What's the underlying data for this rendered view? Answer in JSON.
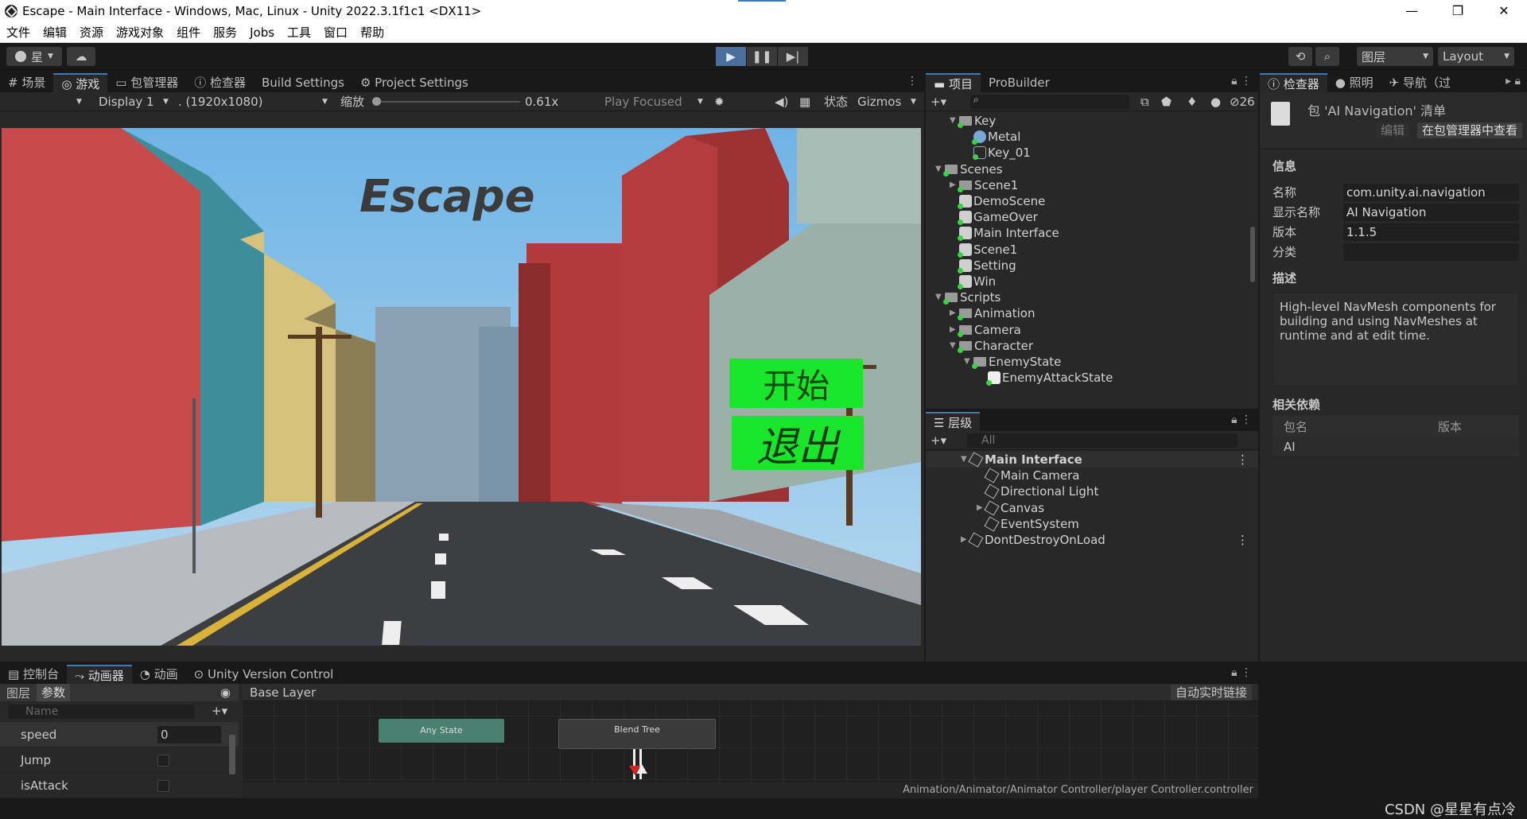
{
  "title_bar": {
    "text": "Escape - Main Interface - Windows, Mac, Linux - Unity 2022.3.1f1c1 <DX11>",
    "min": "—",
    "max": "❐",
    "close": "✕"
  },
  "menu": [
    "文件",
    "编辑",
    "资源",
    "游戏对象",
    "组件",
    "服务",
    "Jobs",
    "工具",
    "窗口",
    "帮助"
  ],
  "toolbar": {
    "account": "星",
    "layers": "图层",
    "layout": "Layout"
  },
  "game_panel": {
    "tabs": [
      "场景",
      "游戏",
      "包管理器",
      "检查器",
      "Build Settings",
      "Project Settings"
    ],
    "display": "Display 1",
    "resolution": ". (1920x1080)",
    "scale_label": "缩放",
    "scale_value": "0.61x",
    "play_mode": "Play Focused",
    "stats": "状态",
    "gizmos": "Gizmos",
    "game_title": "Escape",
    "start_button": "开始",
    "exit_button": "退出"
  },
  "project_panel": {
    "tabs": [
      "项目",
      "ProBuilder"
    ],
    "count": "26",
    "tree": [
      {
        "label": "Key",
        "depth": 2,
        "type": "folder",
        "open": true
      },
      {
        "label": "Metal",
        "depth": 3,
        "type": "material"
      },
      {
        "label": "Key_01",
        "depth": 3,
        "type": "mesh"
      },
      {
        "label": "Scenes",
        "depth": 1,
        "type": "folder",
        "open": true
      },
      {
        "label": "Scene1",
        "depth": 2,
        "type": "folder",
        "open": false
      },
      {
        "label": "DemoScene",
        "depth": 2,
        "type": "scene"
      },
      {
        "label": "GameOver",
        "depth": 2,
        "type": "scene"
      },
      {
        "label": "Main Interface",
        "depth": 2,
        "type": "scene"
      },
      {
        "label": "Scene1",
        "depth": 2,
        "type": "scene"
      },
      {
        "label": "Setting",
        "depth": 2,
        "type": "scene"
      },
      {
        "label": "Win",
        "depth": 2,
        "type": "scene"
      },
      {
        "label": "Scripts",
        "depth": 1,
        "type": "folder",
        "open": true
      },
      {
        "label": "Animation",
        "depth": 2,
        "type": "folder",
        "open": false
      },
      {
        "label": "Camera",
        "depth": 2,
        "type": "folder",
        "open": false
      },
      {
        "label": "Character",
        "depth": 2,
        "type": "folder",
        "open": true
      },
      {
        "label": "EnemyState",
        "depth": 3,
        "type": "folder",
        "open": true
      },
      {
        "label": "EnemyAttackState",
        "depth": 4,
        "type": "script"
      }
    ]
  },
  "hierarchy_panel": {
    "tab": "层级",
    "search_placeholder": "All",
    "items": [
      {
        "label": "Main Interface",
        "depth": 0,
        "bold": true
      },
      {
        "label": "Main Camera",
        "depth": 1
      },
      {
        "label": "Directional Light",
        "depth": 1
      },
      {
        "label": "Canvas",
        "depth": 1,
        "has_children": true
      },
      {
        "label": "EventSystem",
        "depth": 1
      },
      {
        "label": "DontDestroyOnLoad",
        "depth": 0
      }
    ]
  },
  "inspector_panel": {
    "tabs": [
      "检查器",
      "照明",
      "导航（过"
    ],
    "package_title": "包 'AI Navigation' 清单",
    "edit_button": "编辑",
    "view_button": "在包管理器中查看",
    "info_header": "信息",
    "fields": [
      {
        "label": "名称",
        "value": "com.unity.ai.navigation"
      },
      {
        "label": "显示名称",
        "value": "AI Navigation"
      },
      {
        "label": "版本",
        "value": "1.1.5"
      },
      {
        "label": "分类",
        "value": ""
      }
    ],
    "desc_header": "描述",
    "description": "High-level NavMesh components for building and using NavMeshes at runtime and at edit time.",
    "deps_header": "相关依赖",
    "deps_col_name": "包名",
    "deps_col_version": "版本",
    "deps_row": "AI"
  },
  "animator_panel": {
    "tabs": [
      "控制台",
      "动画器",
      "动画",
      "Unity Version Control"
    ],
    "subtabs": [
      "图层",
      "参数"
    ],
    "layer": "Base Layer",
    "live_link": "自动实时链接",
    "search_placeholder": "Name",
    "params": [
      {
        "name": "speed",
        "value": "0",
        "type": "float"
      },
      {
        "name": "Jump",
        "type": "bool"
      },
      {
        "name": "isAttack",
        "type": "bool"
      }
    ],
    "nodes": {
      "any_state": "Any State",
      "blend_tree": "Blend Tree"
    },
    "path": "Animation/Animator/Animator Controller/player Controller.controller"
  },
  "watermark": "CSDN @星星有点冷",
  "colors": {
    "accent": "#3a79bb",
    "button_green": "#19e62a",
    "anystate": "#4a8070"
  }
}
